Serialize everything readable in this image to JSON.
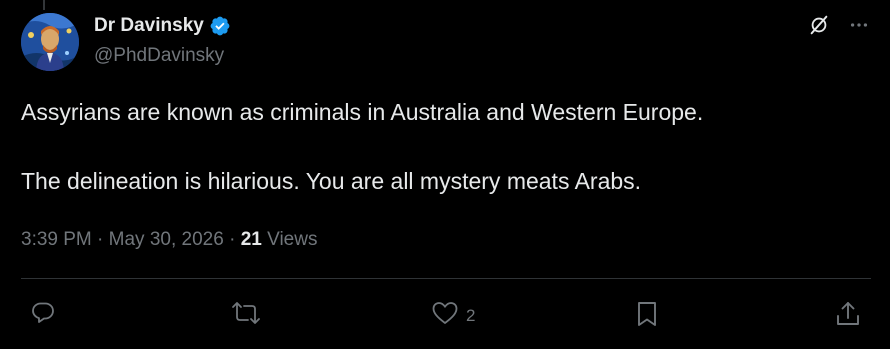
{
  "author": {
    "display_name": "Dr Davinsky",
    "handle": "@PhdDavinsky"
  },
  "tweet": {
    "paragraphs": [
      "Assyrians are known as criminals in Australia and Western Europe.",
      "The delineation is hilarious. You are all mystery meats Arabs."
    ],
    "time": "3:39 PM",
    "date": "May 30, 2026",
    "views_count": "21",
    "views_label": "Views"
  },
  "actions": {
    "reply_count": "",
    "retweet_count": "",
    "like_count": "2"
  },
  "colors": {
    "background": "#000000",
    "text_primary": "#e7e9ea",
    "text_secondary": "#71767b",
    "verified_badge": "#1d9bf0",
    "divider": "#2f3336"
  },
  "icons": {
    "verified": "verified-badge-icon",
    "grok": "grok-icon",
    "more": "more-options-icon",
    "reply": "reply-icon",
    "retweet": "retweet-icon",
    "like": "heart-icon",
    "bookmark": "bookmark-icon",
    "share": "share-icon"
  }
}
